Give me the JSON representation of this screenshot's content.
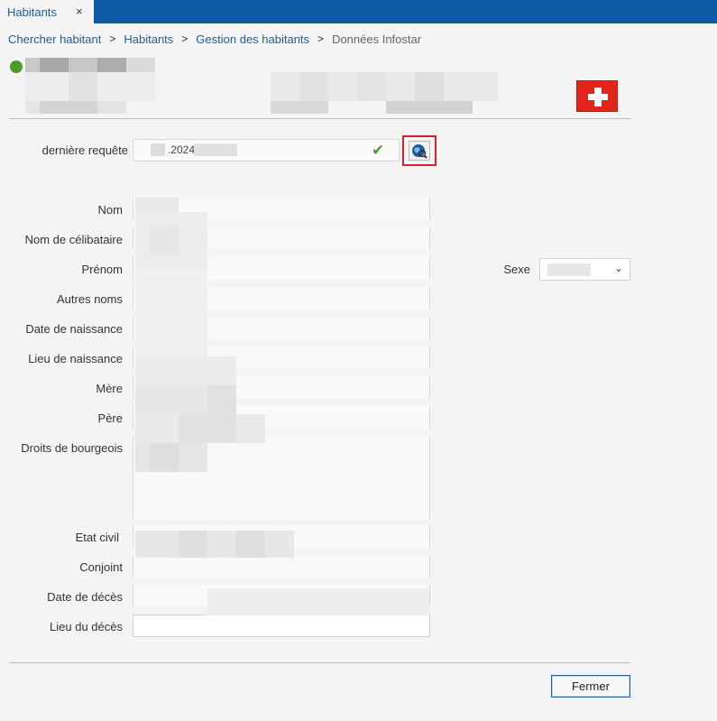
{
  "tab": {
    "title": "Habitants",
    "close": "×"
  },
  "breadcrumb": {
    "items": [
      "Chercher habitant",
      "Habitants",
      "Gestion des habitants"
    ],
    "current": "Données Infostar",
    "separator": ">"
  },
  "query": {
    "label": "dernière requête",
    "value": ".2024",
    "status_icon": "check-icon",
    "action_icon": "globe-search-icon"
  },
  "form": {
    "labels": [
      "Nom",
      "Nom de célibataire",
      "Prénom",
      "Autres noms",
      "Date de naissance",
      "Lieu de naissance",
      "Mère",
      "Père",
      "Droits de bourgeois",
      "Etat civil",
      "Conjoint",
      "Date de décès",
      "Lieu du décès"
    ],
    "sexe_label": "Sexe"
  },
  "footer": {
    "close_label": "Fermer"
  },
  "colors": {
    "accent": "#0f5aa5",
    "link": "#1f5d99",
    "status_ok": "#4f9a2e",
    "highlight": "#d6202a",
    "flag": "#e1251b"
  }
}
